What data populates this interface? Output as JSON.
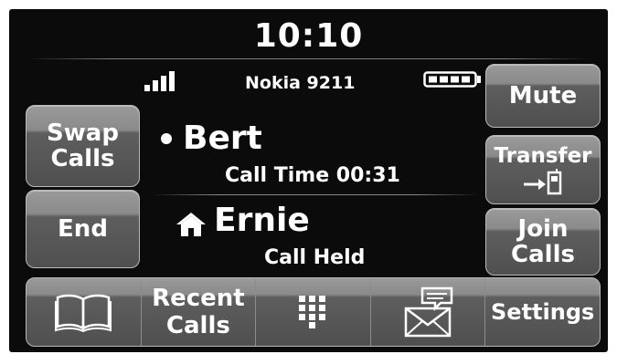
{
  "header": {
    "time": "10:10",
    "device_name": "Nokia 9211"
  },
  "calls": [
    {
      "name": "Bert",
      "status": "Call Time 00:31",
      "indicator": "active-dot"
    },
    {
      "name": "Ernie",
      "status": "Call Held",
      "indicator": "home-icon"
    }
  ],
  "left_buttons": {
    "swap_line1": "Swap",
    "swap_line2": "Calls",
    "end": "End"
  },
  "right_buttons": {
    "mute": "Mute",
    "transfer": "Transfer",
    "transfer_icon": "arrow-to-phone-icon",
    "join_line1": "Join",
    "join_line2": "Calls"
  },
  "bottom_bar": {
    "contacts_icon": "open-book-icon",
    "recent_line1": "Recent",
    "recent_line2": "Calls",
    "keypad_icon": "keypad-icon",
    "messages_icon": "envelope-chat-icon",
    "settings": "Settings"
  },
  "colors": {
    "screen_background": "#0b0b0b",
    "button_top": "#9a9a9a",
    "button_bottom": "#4f4f4f",
    "text": "#ffffff"
  }
}
